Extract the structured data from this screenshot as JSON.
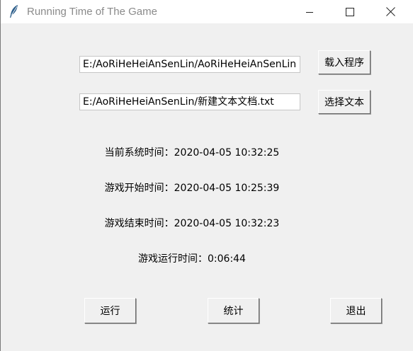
{
  "window": {
    "title": "Running Time of The Game",
    "icon": "feather-icon",
    "controls": [
      "minimize-icon",
      "maximize-icon",
      "close-icon"
    ]
  },
  "program": {
    "path_value": "E:/AoRiHeHeiAnSenLin/AoRiHeHeiAnSenLin",
    "button_label": "载入程序"
  },
  "text_file": {
    "path_value": "E:/AoRiHeHeiAnSenLin/新建文本文档.txt",
    "button_label": "选择文本"
  },
  "info": {
    "current_time": "当前系统时间：2020-04-05 10:32:25",
    "start_time": "游戏开始时间：2020-04-05 10:25:39",
    "end_time": "游戏结束时间：2020-04-05 10:32:23",
    "run_time": "游戏运行时间：0:06:44"
  },
  "actions": {
    "run_label": "运行",
    "stats_label": "统计",
    "exit_label": "退出"
  },
  "colors": {
    "window_bg": "#f0f0f0",
    "titlebar_bg": "#ffffff",
    "title_text": "#8a8a8a"
  }
}
